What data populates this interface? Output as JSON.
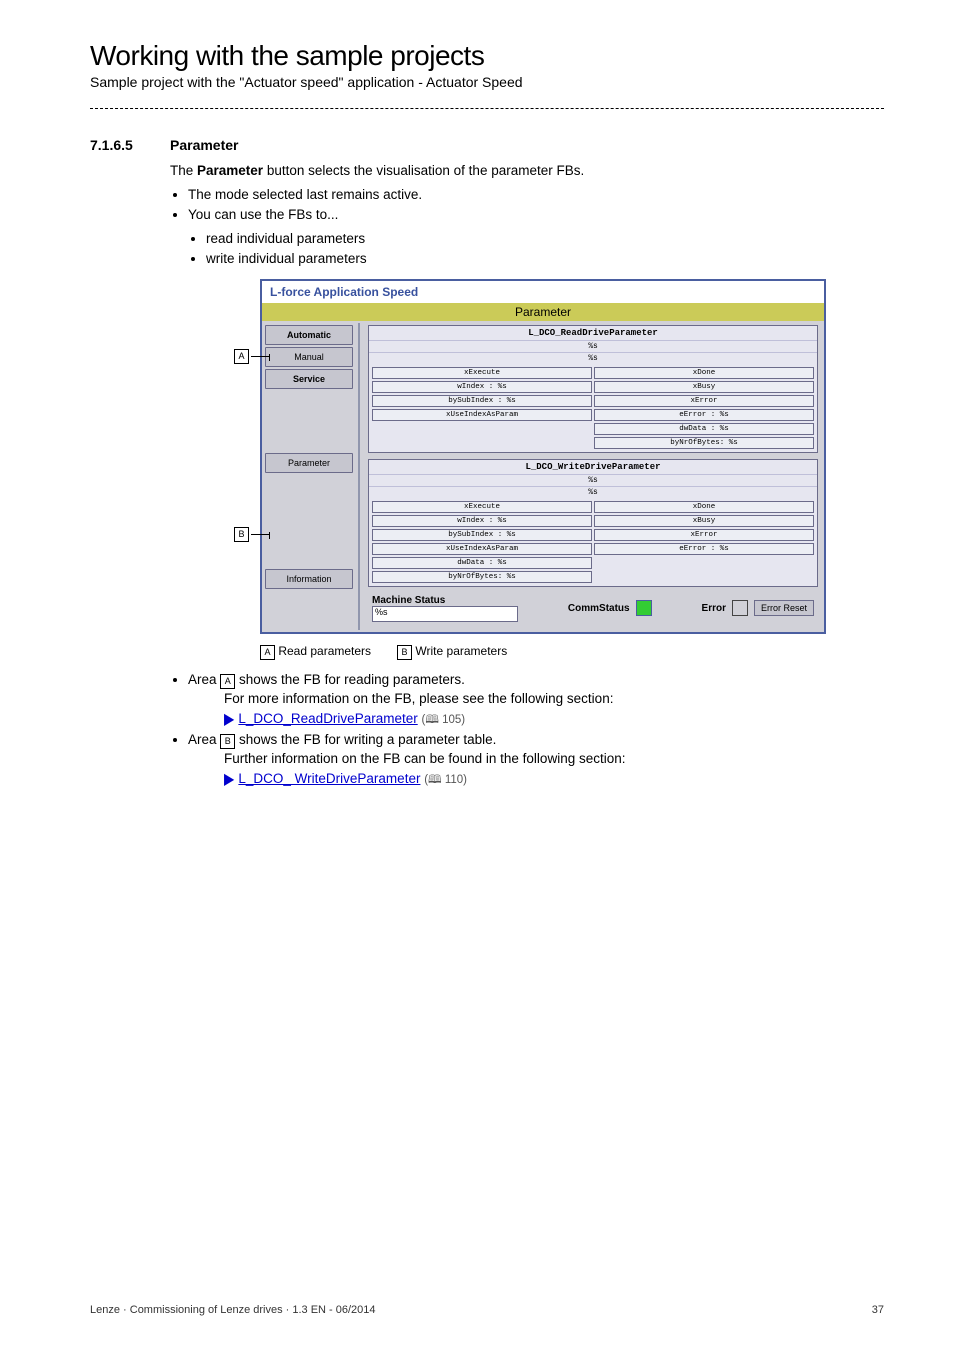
{
  "header": {
    "title": "Working with the sample projects",
    "subtitle": "Sample project with the \"Actuator speed\" application - Actuator Speed"
  },
  "section": {
    "number": "7.1.6.5",
    "title": "Parameter",
    "intro_pre": "The ",
    "intro_bold": "Parameter",
    "intro_post": " button selects the visualisation of the parameter FBs.",
    "bullets1": [
      "The mode selected last remains active.",
      "You can use the FBs to..."
    ],
    "bullets2": [
      "read individual parameters",
      "write individual parameters"
    ]
  },
  "shot": {
    "app_title": "L-force Application Speed",
    "tab": "Parameter",
    "sidebar": {
      "automatic": "Automatic",
      "manual": "Manual",
      "service": "Service",
      "parameter": "Parameter",
      "information": "Information"
    },
    "fb_read": {
      "title": "L_DCO_ReadDriveParameter",
      "sub1": "%s",
      "sub2": "%s",
      "left": [
        "xExecute",
        "wIndex : %s",
        "bySubIndex : %s",
        "xUseIndexAsParam"
      ],
      "right": [
        "xDone",
        "xBusy",
        "xError",
        "eError : %s",
        "dwData : %s",
        "byNrOfBytes: %s"
      ]
    },
    "fb_write": {
      "title": "L_DCO_WriteDriveParameter",
      "sub1": "%s",
      "sub2": "%s",
      "left": [
        "xExecute",
        "wIndex : %s",
        "bySubIndex : %s",
        "xUseIndexAsParam",
        "dwData : %s",
        "byNrOfBytes: %s"
      ],
      "right": [
        "xDone",
        "xBusy",
        "xError",
        "eError : %s"
      ]
    },
    "status": {
      "machine_label": "Machine Status",
      "machine_value": "%s",
      "comm_label": "CommStatus",
      "error_label": "Error",
      "error_reset": "Error Reset"
    }
  },
  "legend": {
    "a": "A",
    "a_text": "Read parameters",
    "b": "B",
    "b_text": "Write parameters"
  },
  "after": {
    "area_a": " shows the FB for reading parameters.",
    "area_a_more": "For more information on the FB, please see the following section:",
    "link_a": "L_DCO_ReadDriveParameter",
    "link_a_page": "105",
    "area_b": " shows the FB for writing a parameter table.",
    "area_b_more": "Further information on the FB can be found in the following section:",
    "link_b": "L_DCO_ WriteDriveParameter",
    "link_b_page": "110",
    "area_word": "Area "
  },
  "footer": {
    "left": "Lenze · Commissioning of Lenze drives · 1.3 EN - 06/2014",
    "right": "37"
  },
  "icons": {
    "book": "▭"
  }
}
